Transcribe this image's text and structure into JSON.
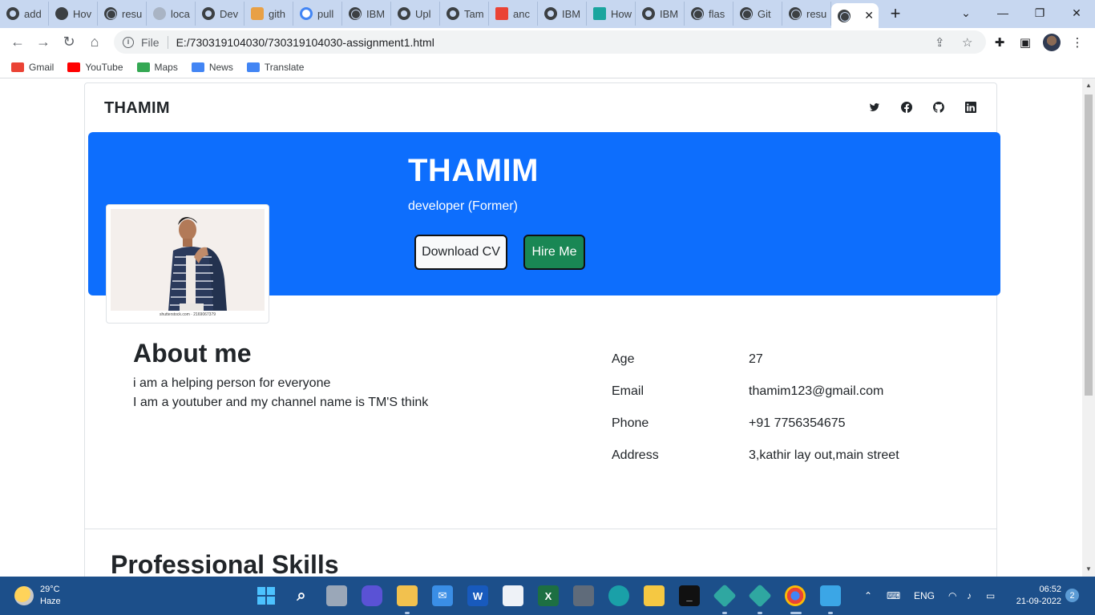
{
  "browser": {
    "tabs": [
      {
        "label": "add",
        "icon": "github-icon"
      },
      {
        "label": "Hov",
        "icon": "hexagon-icon"
      },
      {
        "label": "resu",
        "icon": "globe-icon"
      },
      {
        "label": "loca",
        "icon": "blank-icon"
      },
      {
        "label": "Dev",
        "icon": "github-icon"
      },
      {
        "label": "gith",
        "icon": "stack-icon"
      },
      {
        "label": "pull",
        "icon": "google-icon"
      },
      {
        "label": "IBM",
        "icon": "globe-icon"
      },
      {
        "label": "Upl",
        "icon": "github-icon"
      },
      {
        "label": "Tam",
        "icon": "github-icon"
      },
      {
        "label": "anc",
        "icon": "gmail-icon"
      },
      {
        "label": "IBM",
        "icon": "github-icon"
      },
      {
        "label": "How",
        "icon": "teal-icon"
      },
      {
        "label": "IBM",
        "icon": "github-icon"
      },
      {
        "label": "flas",
        "icon": "globe-icon"
      },
      {
        "label": "Git",
        "icon": "globe-icon"
      },
      {
        "label": "resu",
        "icon": "globe-icon"
      }
    ],
    "active_tab_label": "",
    "address": {
      "scheme": "File",
      "url": "E:/730319104030/730319104030-assignment1.html"
    },
    "bookmarks": [
      {
        "label": "Gmail",
        "color": "#ea4335"
      },
      {
        "label": "YouTube",
        "color": "#ff0000"
      },
      {
        "label": "Maps",
        "color": "#34a853"
      },
      {
        "label": "News",
        "color": "#4285f4"
      },
      {
        "label": "Translate",
        "color": "#4285f4"
      }
    ]
  },
  "page": {
    "brand": "THAMIM",
    "social_icons": [
      "twitter-icon",
      "facebook-icon",
      "github-icon",
      "linkedin-icon"
    ],
    "hero": {
      "name": "THAMIM",
      "role": "developer (Former)",
      "download_label": "Download CV",
      "hire_label": "Hire Me",
      "background_color": "#0d6efd",
      "hire_color": "#198754"
    },
    "photo_caption": "shutterstock.com · 2169067379",
    "about": {
      "title": "About me",
      "lines": [
        "i am a helping person for everyone",
        "I am a youtuber and my channel name is TM'S think"
      ]
    },
    "info": [
      {
        "label": "Age",
        "value": "27"
      },
      {
        "label": "Email",
        "value": "thamim123@gmail.com"
      },
      {
        "label": "Phone",
        "value": "+91 7756354675"
      },
      {
        "label": "Address",
        "value": "3,kathir lay out,main street"
      }
    ],
    "skills_title": "Professional Skills"
  },
  "taskbar": {
    "weather_temp": "29°C",
    "weather_desc": "Haze",
    "language": "ENG",
    "time": "06:52",
    "date": "21-09-2022",
    "notification_count": "2"
  }
}
